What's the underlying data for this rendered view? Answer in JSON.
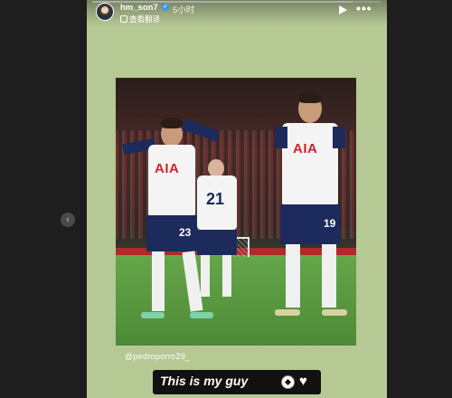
{
  "story": {
    "username": "hm_son7",
    "time": "5小时",
    "translate_label": "查看翻译",
    "progress_fraction": 0.9,
    "mention": "@pedroporro29_",
    "caption": "This is my guy"
  },
  "photo": {
    "players": [
      {
        "sponsor": "AIA",
        "number": "23"
      },
      {
        "sponsor": "",
        "number": "21"
      },
      {
        "sponsor": "AIA",
        "number": "19"
      }
    ]
  },
  "icons": {
    "avatar": "avatar",
    "verified": "verified-badge-icon",
    "play": "play-icon",
    "more": "more-dots-icon",
    "prev": "chevron-left-icon",
    "soccer": "soccer-ball-icon",
    "heart": "white-heart-icon"
  },
  "colors": {
    "story_background": "#b6c894",
    "caption_background": "#111111",
    "kit_navy": "#1c2a5c",
    "sponsor_red": "#d4202a"
  }
}
